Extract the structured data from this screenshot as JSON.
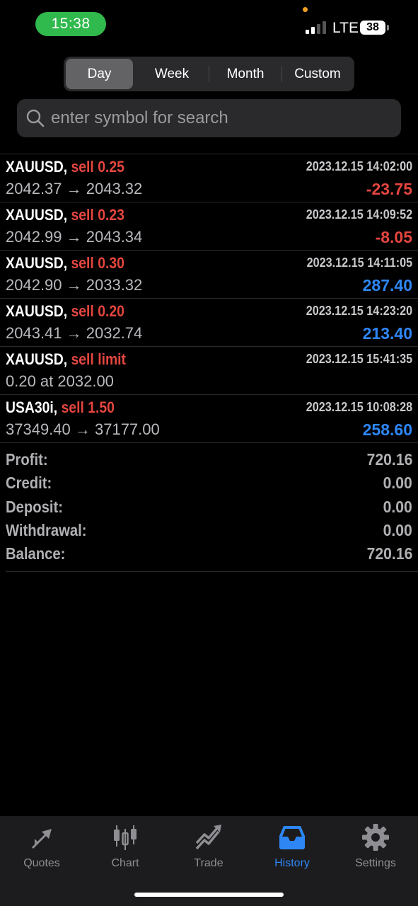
{
  "status_bar": {
    "time": "15:38",
    "network": "LTE",
    "battery": "38"
  },
  "period_tabs": [
    {
      "label": "Day",
      "active": true
    },
    {
      "label": "Week",
      "active": false
    },
    {
      "label": "Month",
      "active": false
    },
    {
      "label": "Custom",
      "active": false
    }
  ],
  "search": {
    "placeholder": "enter symbol for search",
    "value": ""
  },
  "deals": [
    {
      "symbol": "XAUUSD,",
      "action": "sell 0.25",
      "datetime": "2023.12.15 14:02:00",
      "prices": "2042.37 → 2043.32",
      "profit": "-23.75",
      "profit_sign": "negative"
    },
    {
      "symbol": "XAUUSD,",
      "action": "sell 0.23",
      "datetime": "2023.12.15 14:09:52",
      "prices": "2042.99 → 2043.34",
      "profit": "-8.05",
      "profit_sign": "negative"
    },
    {
      "symbol": "XAUUSD,",
      "action": "sell 0.30",
      "datetime": "2023.12.15 14:11:05",
      "prices": "2042.90 → 2033.32",
      "profit": "287.40",
      "profit_sign": "positive"
    },
    {
      "symbol": "XAUUSD,",
      "action": "sell 0.20",
      "datetime": "2023.12.15 14:23:20",
      "prices": "2043.41 → 2032.74",
      "profit": "213.40",
      "profit_sign": "positive"
    },
    {
      "symbol": "XAUUSD,",
      "action": "sell limit",
      "datetime": "2023.12.15 15:41:35",
      "prices": "0.20 at 2032.00",
      "profit": "",
      "profit_sign": "none"
    },
    {
      "symbol": "USA30i,",
      "action": "sell 1.50",
      "datetime": "2023.12.15 10:08:28",
      "prices": "37349.40 → 37177.00",
      "profit": "258.60",
      "profit_sign": "positive"
    }
  ],
  "summary": [
    {
      "label": "Profit:",
      "value": "720.16"
    },
    {
      "label": "Credit:",
      "value": "0.00"
    },
    {
      "label": "Deposit:",
      "value": "0.00"
    },
    {
      "label": "Withdrawal:",
      "value": "0.00"
    },
    {
      "label": "Balance:",
      "value": "720.16"
    }
  ],
  "tabbar": [
    {
      "label": "Quotes",
      "icon": "quotes-arrows-icon",
      "active": false
    },
    {
      "label": "Chart",
      "icon": "candlestick-chart-icon",
      "active": false
    },
    {
      "label": "Trade",
      "icon": "trade-trend-icon",
      "active": false
    },
    {
      "label": "History",
      "icon": "history-inbox-icon",
      "active": true
    },
    {
      "label": "Settings",
      "icon": "gear-icon",
      "active": false
    }
  ],
  "colors": {
    "sell": "#e4463f",
    "profit_positive": "#2e86f5",
    "profit_negative": "#e4463f",
    "tab_active": "#2e86f5",
    "time_pill": "#30b94d"
  }
}
